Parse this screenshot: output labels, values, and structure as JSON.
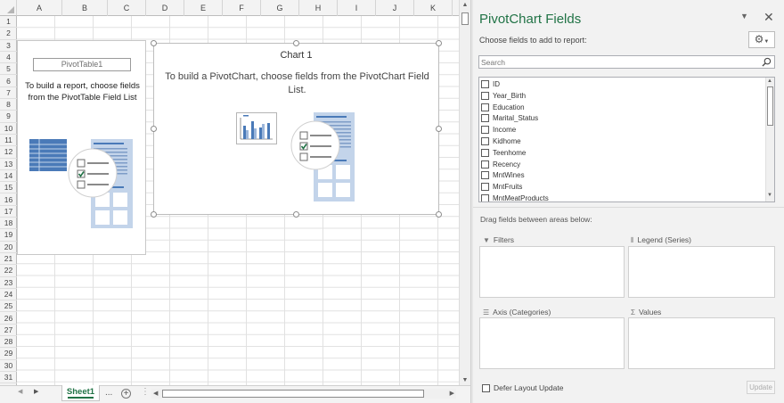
{
  "sheet": {
    "columns": [
      "A",
      "B",
      "C",
      "D",
      "E",
      "F",
      "G",
      "H",
      "I",
      "J",
      "K"
    ],
    "rows": [
      "1",
      "2",
      "3",
      "4",
      "5",
      "6",
      "7",
      "8",
      "9",
      "10",
      "11",
      "12",
      "13",
      "14",
      "15",
      "16",
      "17",
      "18",
      "19",
      "20",
      "21",
      "22",
      "23",
      "24",
      "25",
      "26",
      "27",
      "28",
      "29",
      "30",
      "31"
    ],
    "tab_name": "Sheet1",
    "tab_ellipsis": "..."
  },
  "pivot_table": {
    "name": "PivotTable1",
    "message": "To build a report, choose fields from the PivotTable Field List"
  },
  "chart": {
    "title": "Chart 1",
    "message": "To build a PivotChart, choose fields from the PivotChart Field List."
  },
  "pane": {
    "title": "PivotChart Fields",
    "choose_label": "Choose fields to add to report:",
    "search_placeholder": "Search",
    "fields": [
      "ID",
      "Year_Birth",
      "Education",
      "Marital_Status",
      "Income",
      "Kidhome",
      "Teenhome",
      "Recency",
      "MntWines",
      "MntFruits",
      "MntMeatProducts"
    ],
    "drag_label": "Drag fields between areas below:",
    "areas": {
      "filters": "Filters",
      "legend": "Legend (Series)",
      "axis": "Axis (Categories)",
      "values": "Values"
    },
    "defer_label": "Defer Layout Update",
    "update_label": "Update"
  },
  "colors": {
    "accent": "#217346",
    "illustration_blue": "#4a7ab8",
    "illustration_light": "#c3d4ea"
  }
}
